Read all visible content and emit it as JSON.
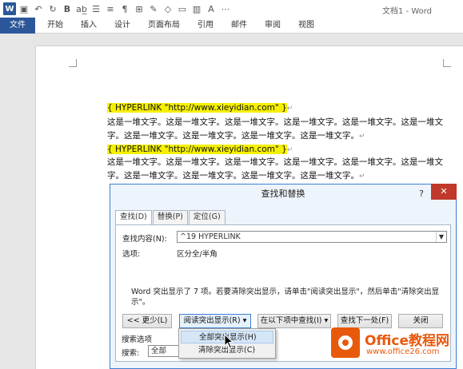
{
  "window": {
    "title": "文档1 - Word"
  },
  "ribbon_tabs": [
    "文件",
    "开始",
    "插入",
    "设计",
    "页面布局",
    "引用",
    "邮件",
    "审阅",
    "视图"
  ],
  "document": {
    "lines": [
      {
        "field": "{ HYPERLINK \"http://www.xieyidian.com\" }",
        "mark": "↵"
      },
      {
        "text": "这是一堆文字。这是一堆文字。这是一堆文字。这是一堆文字。这是一堆文字。这是一堆文"
      },
      {
        "text": "字。这是一堆文字。这是一堆文字。这是一堆文字。这是一堆文字。",
        "mark": "↵"
      },
      {
        "field": "{ HYPERLINK \"http://www.xieyidian.com\" }",
        "mark": "↵"
      },
      {
        "text": "这是一堆文字。这是一堆文字。这是一堆文字。这是一堆文字。这是一堆文字。这是一堆文"
      },
      {
        "text": "字。这是一堆文字。这是一堆文字。这是一堆文字。这是一堆文字。",
        "mark": "↵"
      }
    ]
  },
  "dialog": {
    "title": "查找和替换",
    "help": "?",
    "close": "✕",
    "tabs": [
      "查找(D)",
      "替换(P)",
      "定位(G)"
    ],
    "find_label": "查找内容(N):",
    "find_value": "^19 HYPERLINK",
    "options_label": "选项:",
    "options_value": "区分全/半角",
    "message": "Word 突出显示了 7 项。若要清除突出显示，请单击\"阅读突出显示\"，然后单击\"清除突出显示\"。",
    "buttons": {
      "less": "<< 更少(L)",
      "reading_highlight": "阅读突出显示(R) ▾",
      "find_in": "在以下项中查找(I) ▾",
      "find_next": "查找下一处(F)",
      "close": "关闭"
    },
    "search_options_label": "搜索选项",
    "search_label": "搜索:",
    "search_value": "全部"
  },
  "dropdown_menu": {
    "items": [
      "全部突出显示(H)",
      "清除突出显示(C)"
    ]
  },
  "watermark": {
    "brand": "Office教程网",
    "url": "www.office26.com"
  },
  "colors": {
    "accent": "#2b579a",
    "highlight": "#f5f000",
    "close": "#c0392b",
    "brand": "#e8590c"
  }
}
